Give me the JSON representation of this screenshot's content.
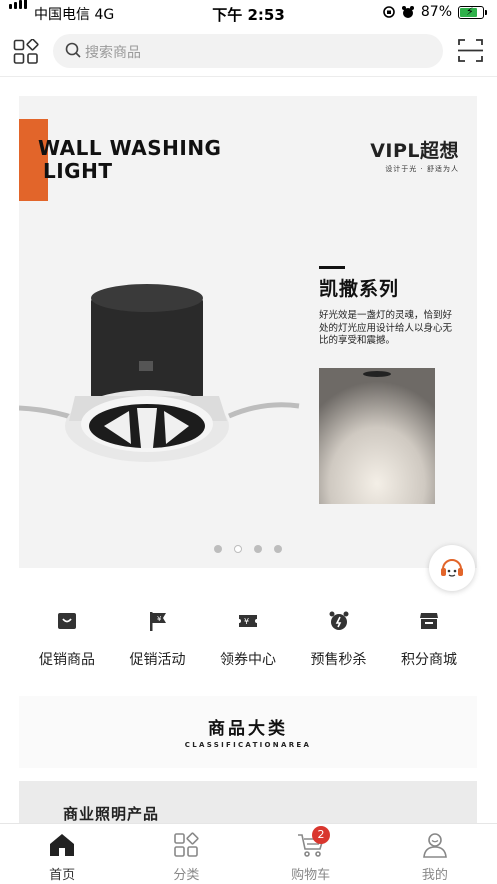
{
  "status_bar": {
    "carrier": "中国电信 4G",
    "time": "下午 2:53",
    "battery_percent": "87%",
    "battery_level": 0.87
  },
  "search": {
    "placeholder": "搜索商品"
  },
  "banner": {
    "headline_line1": "WALL WASHING",
    "headline_line2": "LIGHT",
    "brand_name": "VIPL超想",
    "brand_slogan": "设计于光 · 舒适为人",
    "series_title": "凯撒系列",
    "series_description": "好光效是一盏灯的灵魂，恰到好处的灯光应用设计给人以身心无比的享受和震撼。",
    "accent_color": "#e2652a",
    "carousel_total": 4,
    "carousel_active_index": 2
  },
  "quick_menu": [
    {
      "label": "促销商品",
      "icon": "promo-goods-icon"
    },
    {
      "label": "促销活动",
      "icon": "promo-flag-icon"
    },
    {
      "label": "领券中心",
      "icon": "coupon-icon"
    },
    {
      "label": "预售秒杀",
      "icon": "alarm-clock-icon"
    },
    {
      "label": "积分商城",
      "icon": "points-store-icon"
    }
  ],
  "classification": {
    "title": "商品大类",
    "subtitle": "CLASSIFICATIONAREA"
  },
  "product_section": {
    "title": "商业照明产品"
  },
  "tab_bar": {
    "tabs": [
      {
        "label": "首页",
        "icon": "home-icon",
        "active": true
      },
      {
        "label": "分类",
        "icon": "category-icon",
        "active": false
      },
      {
        "label": "购物车",
        "icon": "cart-icon",
        "active": false
      },
      {
        "label": "我的",
        "icon": "profile-icon",
        "active": false
      }
    ],
    "cart_badge": "2",
    "badge_color": "#d9362e"
  }
}
